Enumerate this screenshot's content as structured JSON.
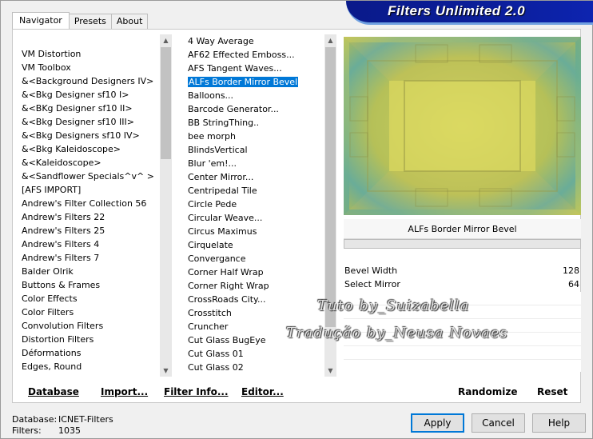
{
  "banner": {
    "title": "Filters Unlimited 2.0"
  },
  "tabs": [
    {
      "label": "Navigator",
      "active": true
    },
    {
      "label": "Presets",
      "active": false
    },
    {
      "label": "About",
      "active": false
    }
  ],
  "categories": [
    "VM Distortion",
    "VM Toolbox",
    "&<Background Designers IV>",
    "&<Bkg Designer sf10 I>",
    "&<BKg Designer sf10 II>",
    "&<Bkg Designer sf10 III>",
    "&<Bkg Designers sf10 IV>",
    "&<Bkg Kaleidoscope>",
    "&<Kaleidoscope>",
    "&<Sandflower Specials^v^ >",
    "[AFS IMPORT]",
    "Andrew's Filter Collection 56",
    "Andrew's Filters 22",
    "Andrew's Filters 25",
    "Andrew's Filters 4",
    "Andrew's Filters 7",
    "Balder Olrik",
    "Buttons & Frames",
    "Color Effects",
    "Color Filters",
    "Convolution Filters",
    "Distortion Filters",
    "Déformations",
    "Edges, Round"
  ],
  "filters": [
    "4 Way Average",
    "AF62 Effected Emboss...",
    "AFS Tangent Waves...",
    "ALFs Border Mirror Bevel",
    "Balloons...",
    "Barcode Generator...",
    "BB StringThing..",
    "bee morph",
    "BlindsVertical",
    "Blur 'em!...",
    "Center Mirror...",
    "Centripedal Tile",
    "Circle Pede",
    "Circular Weave...",
    "Circus Maximus",
    "Cirquelate",
    "Convergance",
    "Corner Half Wrap",
    "Corner Right Wrap",
    "CrossRoads City...",
    "Crosstitch",
    "Cruncher",
    "Cut Glass  BugEye",
    "Cut Glass 01",
    "Cut Glass 02"
  ],
  "selected_filter_index": 3,
  "selected_filter_name": "ALFs Border Mirror Bevel",
  "params": [
    {
      "label": "Bevel Width",
      "value": "128"
    },
    {
      "label": "Select Mirror",
      "value": "64"
    }
  ],
  "preview_colors": {
    "yellow": "#d8d860",
    "teal": "#3aa8c0",
    "olive": "#9aa050"
  },
  "bottom_links": {
    "database": "Database",
    "import": "Import...",
    "filter_info": "Filter Info...",
    "editor": "Editor...",
    "randomize": "Randomize",
    "reset": "Reset"
  },
  "footer": {
    "database_label": "Database:",
    "database_value": "ICNET-Filters",
    "filters_label": "Filters:",
    "filters_value": "1035"
  },
  "buttons": {
    "apply": "Apply",
    "cancel": "Cancel",
    "help": "Help"
  },
  "watermark": {
    "line1": "Tuto by_Suizabella",
    "line2": "Tradução by_Neusa Novaes"
  }
}
